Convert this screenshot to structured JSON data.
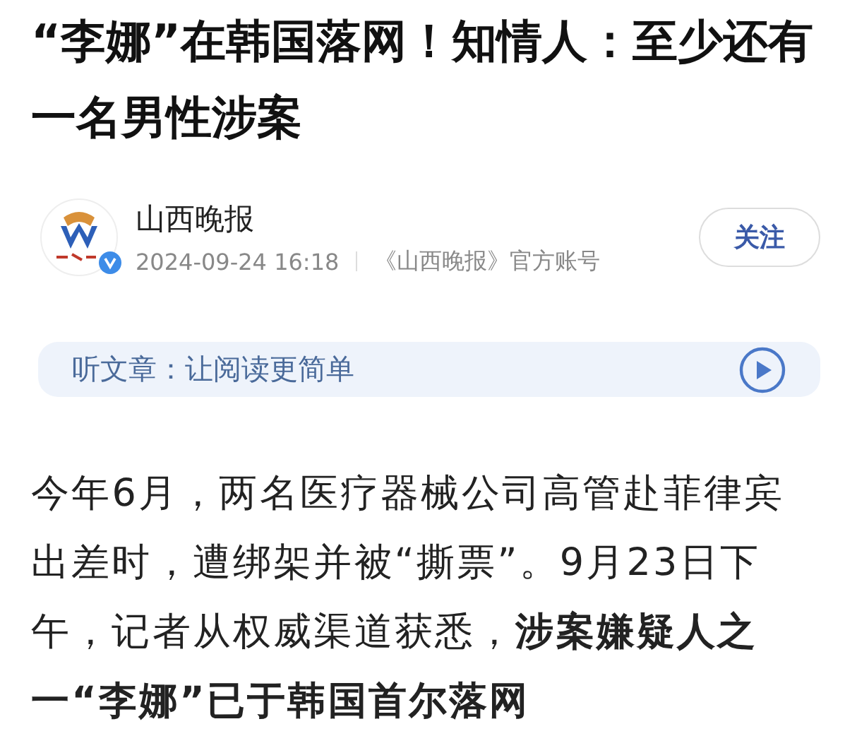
{
  "headline": "“李娜”在韩国落网！知情人：至少还有一名男性涉案",
  "author": {
    "name": "山西晚报",
    "date": "2024-09-24 16:18",
    "account": "《山西晚报》官方账号",
    "verified": true,
    "follow_label": "关注"
  },
  "listen_bar": {
    "label": "听文章：让阅读更简单"
  },
  "body": "今年6月，两名医疗器械公司高管赴菲律宾出差时，遭绑架并被“撕票”。9月23日下午，记者从权威渠道获悉，**涉案嫌疑人之一“李娜”已于韩国首尔落网**"
}
